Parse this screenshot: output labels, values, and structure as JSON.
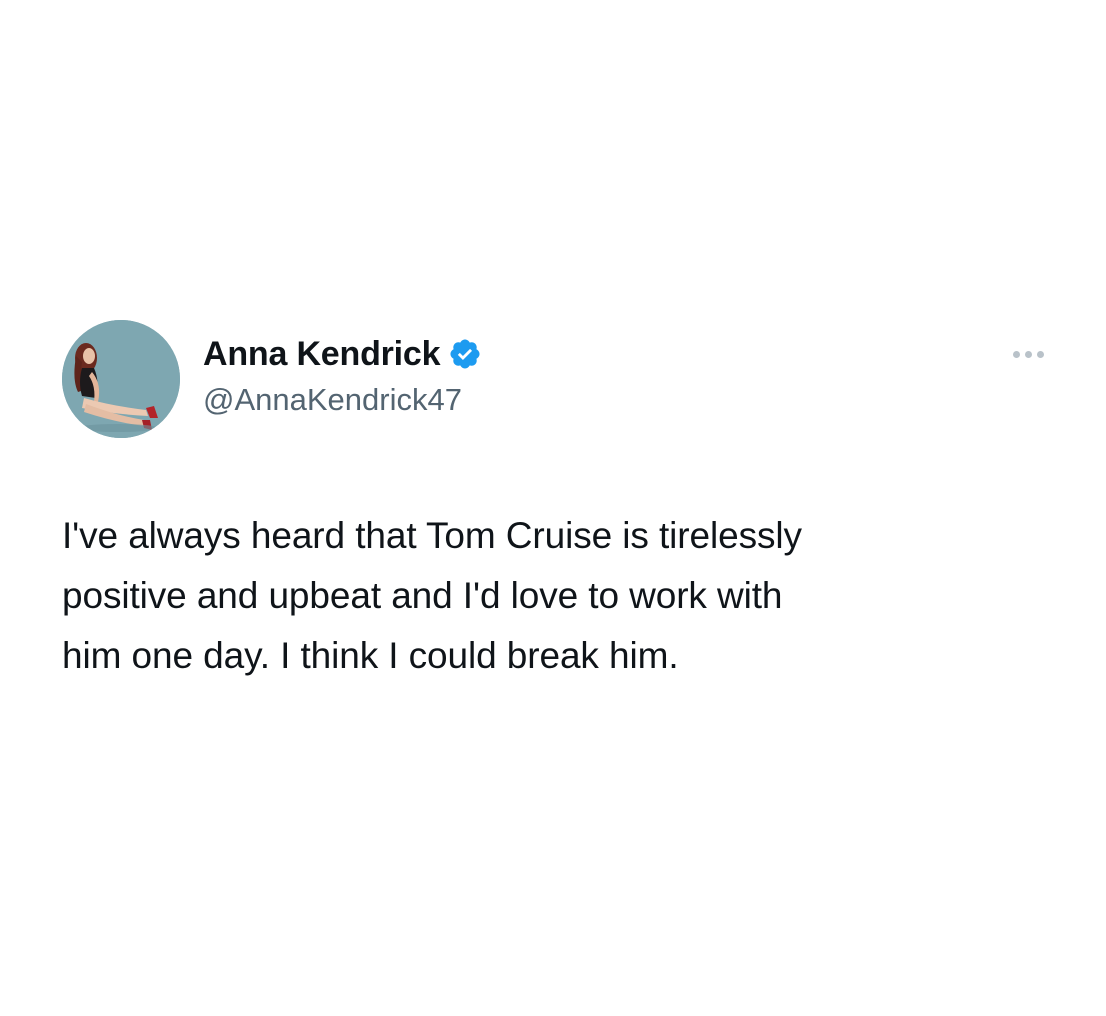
{
  "tweet": {
    "author": {
      "display_name": "Anna Kendrick",
      "handle": "@AnnaKendrick47",
      "verified": true,
      "avatar_icon": "profile-photo",
      "badge_icon": "verified-badge-icon",
      "badge_color": "#1d9bf0"
    },
    "more_icon": "more-options-icon",
    "text": "I've always heard that Tom Cruise is tirelessly\npositive and upbeat and I'd love to work with\nhim one day. I think I could break him."
  },
  "colors": {
    "background": "#ffffff",
    "name_text": "#0f1419",
    "handle_text": "#536471",
    "body_text": "#0f1419",
    "more_dots": "#b9c2c9"
  }
}
